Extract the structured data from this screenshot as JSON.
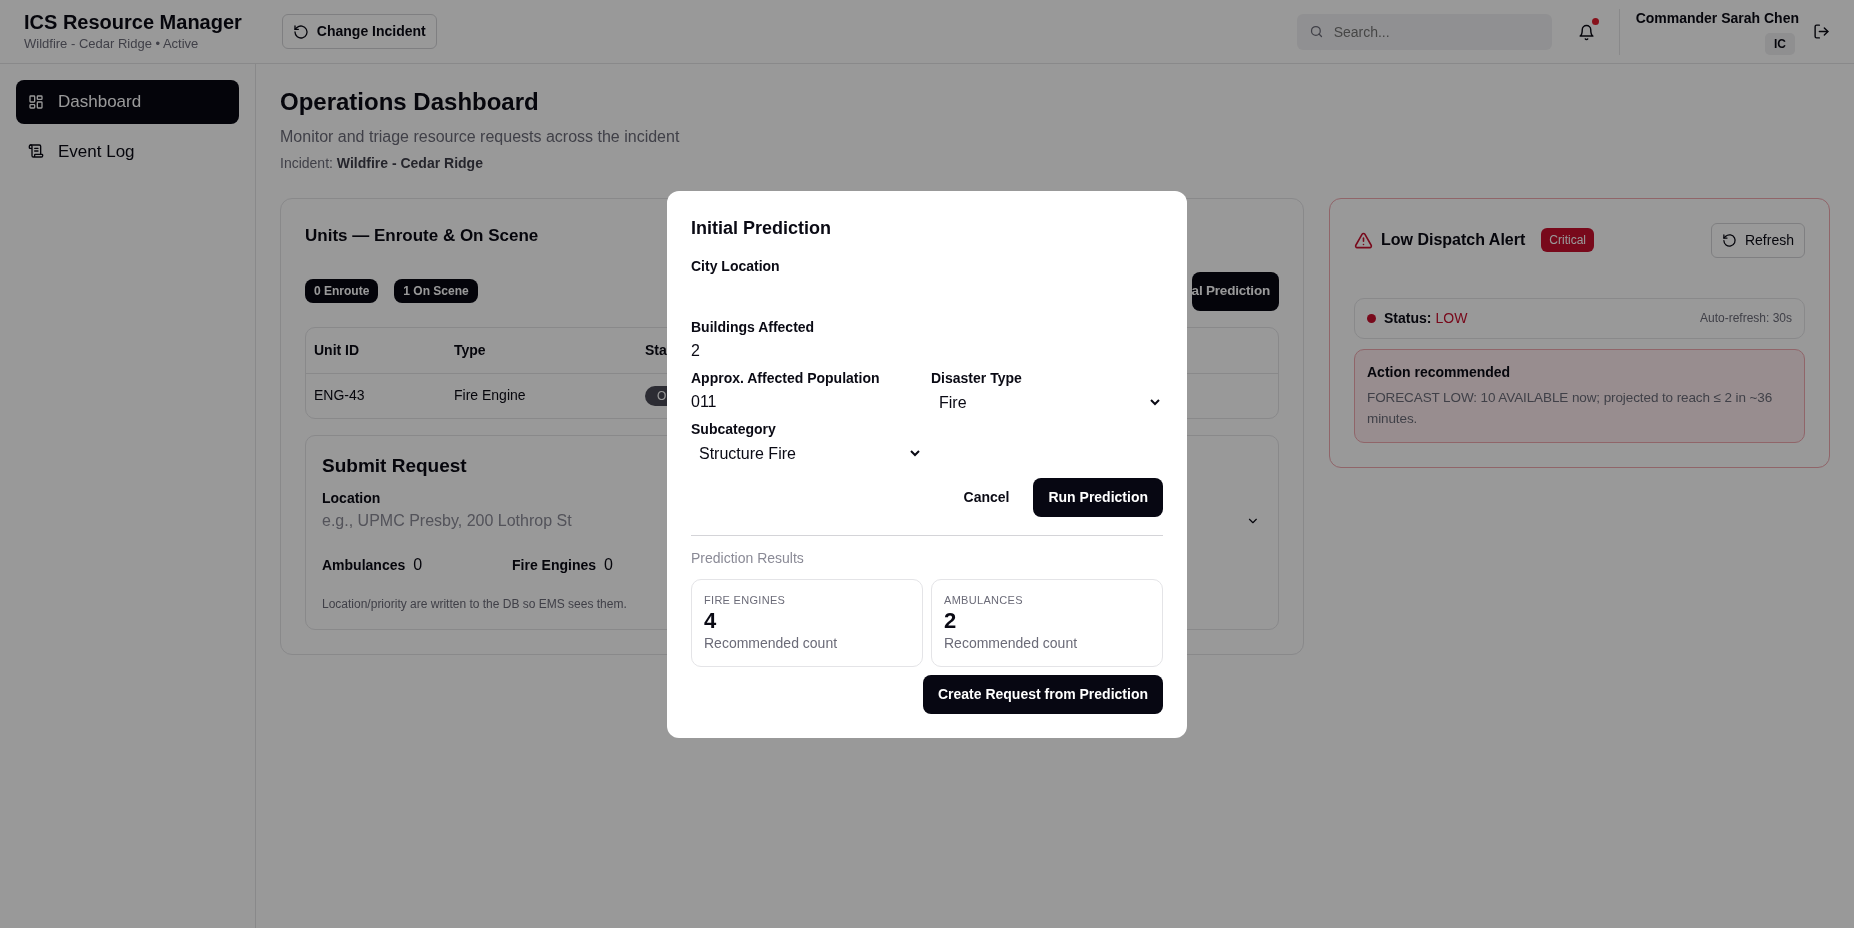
{
  "header": {
    "app_title": "ICS Resource Manager",
    "incident_subtitle": "Wildfire - Cedar Ridge • Active",
    "change_button": "Change Incident",
    "search": {
      "placeholder": "Search..."
    },
    "notifications": {
      "unread": true
    },
    "user": {
      "name": "Commander Sarah Chen",
      "role": "IC"
    }
  },
  "sidebar": {
    "items": [
      {
        "label": "Dashboard",
        "selected": true,
        "kind": "grid"
      },
      {
        "label": "Event Log",
        "selected": false,
        "kind": "scroll"
      }
    ]
  },
  "page": {
    "title": "Operations Dashboard",
    "subtitle": "Monitor and triage resource requests across the incident",
    "incident_label": "Incident:",
    "incident_name": "Wildfire - Cedar Ridge"
  },
  "units_card": {
    "title": "Units — Enroute & On Scene",
    "badges": [
      "0 Enroute",
      "1 On Scene"
    ],
    "action_button": "al Prediction",
    "table": {
      "columns": [
        "Unit ID",
        "Type",
        "Sta"
      ],
      "rows": [
        [
          "ENG-43",
          "Fire Engine",
          "O"
        ]
      ]
    }
  },
  "submit_card": {
    "title": "Submit Request",
    "location_label": "Location",
    "location_placeholder": "e.g., UPMC Presby, 200 Lothrop St",
    "counts": [
      {
        "label": "Ambulances",
        "value": "0"
      },
      {
        "label": "Fire Engines",
        "value": "0"
      }
    ],
    "note": "Location/priority are written to the DB so EMS sees them."
  },
  "alert_card": {
    "title": "Low Dispatch Alert",
    "severity": "Critical",
    "refresh_button": "Refresh",
    "status_label": "Status:",
    "status_value": "LOW",
    "status_alarm": true,
    "auto_refresh": "Auto-refresh: 30s",
    "action_title": "Action recommended",
    "action_text": "FORECAST LOW: 10 AVAILABLE now; projected to reach ≤ 2 in ~36 minutes."
  },
  "modal": {
    "title": "Initial Prediction",
    "fields": [
      {
        "kind": "input",
        "label": "City Location"
      },
      {
        "kind": "input",
        "label": "Buildings Affected",
        "value": "2"
      },
      {
        "kind": "input",
        "label": "Approx. Affected Population",
        "value": "011"
      },
      {
        "kind": "select",
        "label": "Disaster Type",
        "value": "Fire"
      },
      {
        "kind": "select",
        "label": "Subcategory",
        "value": "Structure Fire"
      }
    ],
    "cancel_button": "Cancel",
    "run_button": "Run Prediction",
    "results_title": "Prediction Results",
    "results": [
      {
        "label": "FIRE ENGINES",
        "value": "4",
        "caption": "Recommended count"
      },
      {
        "label": "AMBULANCES",
        "value": "2",
        "caption": "Recommended count"
      }
    ],
    "create_button": "Create Request from Prediction"
  }
}
